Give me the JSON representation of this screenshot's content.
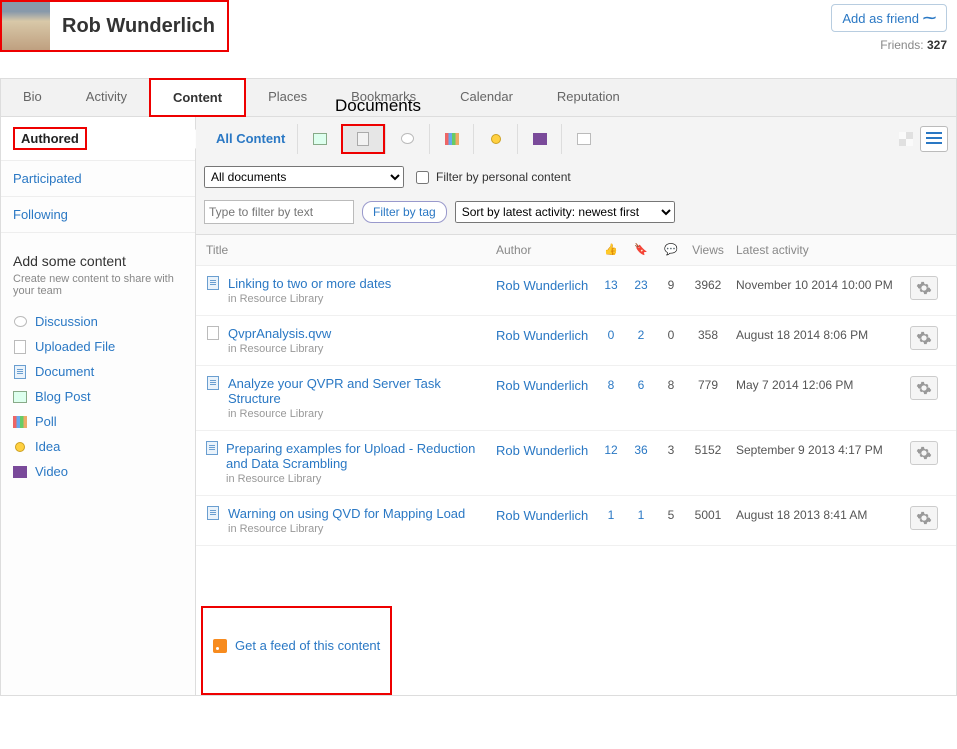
{
  "profile": {
    "name": "Rob Wunderlich"
  },
  "header": {
    "add_friend": "Add as friend",
    "friends_label": "Friends:",
    "friends_count": "327"
  },
  "annotation": {
    "documents": "Documents"
  },
  "tabs": [
    "Bio",
    "Activity",
    "Content",
    "Places",
    "Bookmarks",
    "Calendar",
    "Reputation"
  ],
  "active_tab": "Content",
  "side": {
    "tabs": [
      "Authored",
      "Participated",
      "Following"
    ],
    "active": "Authored",
    "add_title": "Add some content",
    "add_sub": "Create new content to share with your team",
    "links": [
      {
        "icon": "bubble",
        "label": "Discussion"
      },
      {
        "icon": "file",
        "label": "Uploaded File"
      },
      {
        "icon": "doc",
        "label": "Document"
      },
      {
        "icon": "img",
        "label": "Blog Post"
      },
      {
        "icon": "chart",
        "label": "Poll"
      },
      {
        "icon": "bulb",
        "label": "Idea"
      },
      {
        "icon": "vid",
        "label": "Video"
      }
    ]
  },
  "toolbar": {
    "all_content": "All Content",
    "doc_select": "All documents",
    "personal_filter": "Filter by personal content",
    "text_placeholder": "Type to filter by text",
    "filter_by_tag": "Filter by tag",
    "sort": "Sort by latest activity: newest first"
  },
  "columns": {
    "title": "Title",
    "author": "Author",
    "views": "Views",
    "latest": "Latest activity"
  },
  "rows": [
    {
      "icon": "doc",
      "title": "Linking to two or more dates",
      "loc": "in Resource Library",
      "author": "Rob Wunderlich",
      "m1": "13",
      "m2": "23",
      "m3": "9",
      "views": "3962",
      "date": "November 10 2014 10:00 PM"
    },
    {
      "icon": "file",
      "title": "QvprAnalysis.qvw",
      "loc": "in Resource Library",
      "author": "Rob Wunderlich",
      "m1": "0",
      "m2": "2",
      "m3": "0",
      "views": "358",
      "date": "August 18 2014 8:06 PM"
    },
    {
      "icon": "doc",
      "title": "Analyze your QVPR and Server Task Structure",
      "loc": "in Resource Library",
      "author": "Rob Wunderlich",
      "m1": "8",
      "m2": "6",
      "m3": "8",
      "views": "779",
      "date": "May 7 2014 12:06 PM"
    },
    {
      "icon": "doc",
      "title": "Preparing examples for Upload - Reduction and Data Scrambling",
      "loc": "in Resource Library",
      "author": "Rob Wunderlich",
      "m1": "12",
      "m2": "36",
      "m3": "3",
      "views": "5152",
      "date": "September 9 2013 4:17 PM"
    },
    {
      "icon": "doc",
      "title": "Warning on using QVD for Mapping Load",
      "loc": "in Resource Library",
      "author": "Rob Wunderlich",
      "m1": "1",
      "m2": "1",
      "m3": "5",
      "views": "5001",
      "date": "August 18 2013 8:41 AM"
    }
  ],
  "feed": "Get a feed of this content"
}
